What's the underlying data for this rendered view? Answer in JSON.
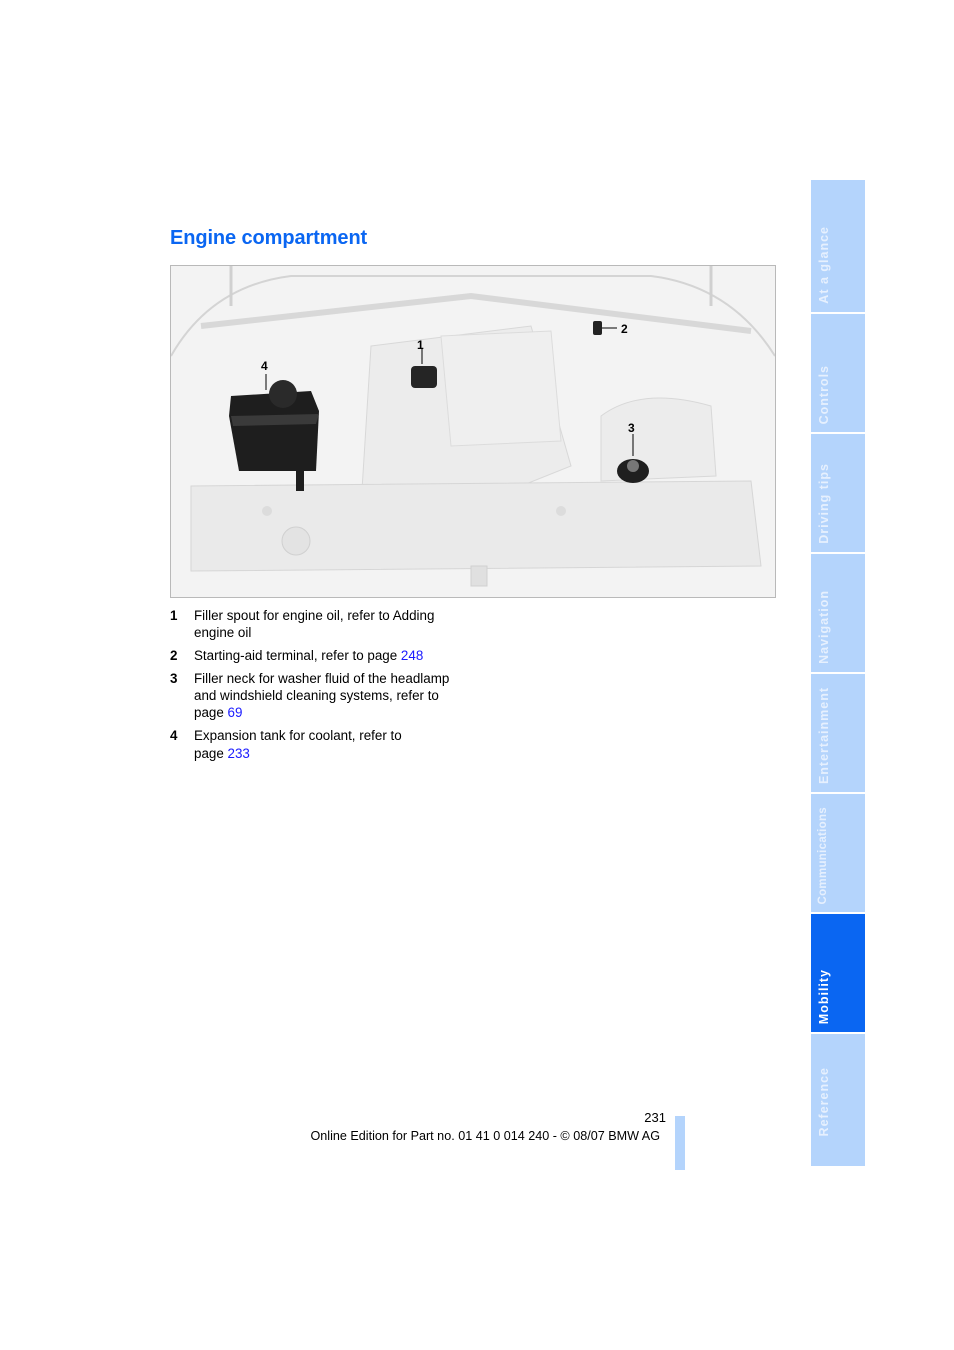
{
  "page": {
    "title": "Engine compartment",
    "figure": {
      "alt": "Engine compartment illustration",
      "callouts": [
        "1",
        "2",
        "3",
        "4"
      ]
    },
    "legend": [
      {
        "num": "1",
        "text": "Filler spout for engine oil, refer to Adding engine oil",
        "link": null
      },
      {
        "num": "2",
        "text": "Starting-aid terminal, refer to page ",
        "link": "248"
      },
      {
        "num": "3",
        "text": "Filler neck for washer fluid of the headlamp and windshield cleaning systems, refer to page ",
        "link": "69"
      },
      {
        "num": "4",
        "text": "Expansion tank for coolant, refer to page ",
        "link": "233"
      }
    ],
    "page_number": "231",
    "footer": "Online Edition for Part no. 01 41 0 014 240 - © 08/07 BMW AG"
  },
  "tabs": [
    {
      "label": "At a glance",
      "active": false
    },
    {
      "label": "Controls",
      "active": false
    },
    {
      "label": "Driving tips",
      "active": false
    },
    {
      "label": "Navigation",
      "active": false
    },
    {
      "label": "Entertainment",
      "active": false
    },
    {
      "label": "Communications",
      "active": false
    },
    {
      "label": "Mobility",
      "active": true
    },
    {
      "label": "Reference",
      "active": false
    }
  ],
  "colors": {
    "heading": "#0a66f2",
    "link": "#1a1aff",
    "tab_inactive": "#b4d4fc",
    "tab_active": "#0a66f2"
  }
}
